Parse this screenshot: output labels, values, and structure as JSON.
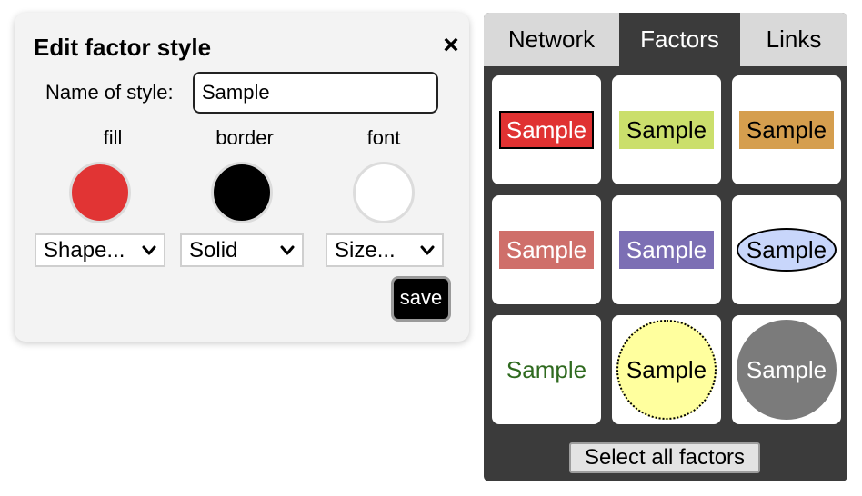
{
  "dialog": {
    "title": "Edit factor style",
    "close_icon": "×",
    "name_label": "Name of style:",
    "name_value": "Sample",
    "columns": {
      "fill": {
        "label": "fill",
        "color": "#e13434",
        "select": "Shape..."
      },
      "border": {
        "label": "border",
        "color": "#000000",
        "select": "Solid"
      },
      "font": {
        "label": "font",
        "color": "#ffffff",
        "select": "Size..."
      }
    },
    "save_label": "save"
  },
  "panel": {
    "tabs": [
      {
        "label": "Network",
        "active": false
      },
      {
        "label": "Factors",
        "active": true
      },
      {
        "label": "Links",
        "active": false
      }
    ],
    "samples": [
      {
        "text": "Sample",
        "shape": "box",
        "fill": "#e03232",
        "border": "#000000",
        "font_color": "#ffffff"
      },
      {
        "text": "Sample",
        "shape": "box",
        "fill": "#cbdf6c",
        "border": "none",
        "font_color": "#000000"
      },
      {
        "text": "Sample",
        "shape": "box",
        "fill": "#d59e4e",
        "border": "none",
        "font_color": "#000000"
      },
      {
        "text": "Sample",
        "shape": "box",
        "fill": "#cf6f6a",
        "border": "none",
        "font_color": "#ffffff"
      },
      {
        "text": "Sample",
        "shape": "box",
        "fill": "#7c6fb4",
        "border": "none",
        "font_color": "#ffffff"
      },
      {
        "text": "Sample",
        "shape": "ellipse",
        "fill": "#c8d6fb",
        "border": "#000000",
        "font_color": "#000000"
      },
      {
        "text": "Sample",
        "shape": "text",
        "fill": "none",
        "border": "none",
        "font_color": "#2f6a1f"
      },
      {
        "text": "Sample",
        "shape": "circle",
        "fill": "#ffff9e",
        "border": "dotted #000000",
        "font_color": "#000000"
      },
      {
        "text": "Sample",
        "shape": "circle",
        "fill": "#7b7b7b",
        "border": "none",
        "font_color": "#ffffff"
      }
    ],
    "select_all_label": "Select all factors"
  }
}
